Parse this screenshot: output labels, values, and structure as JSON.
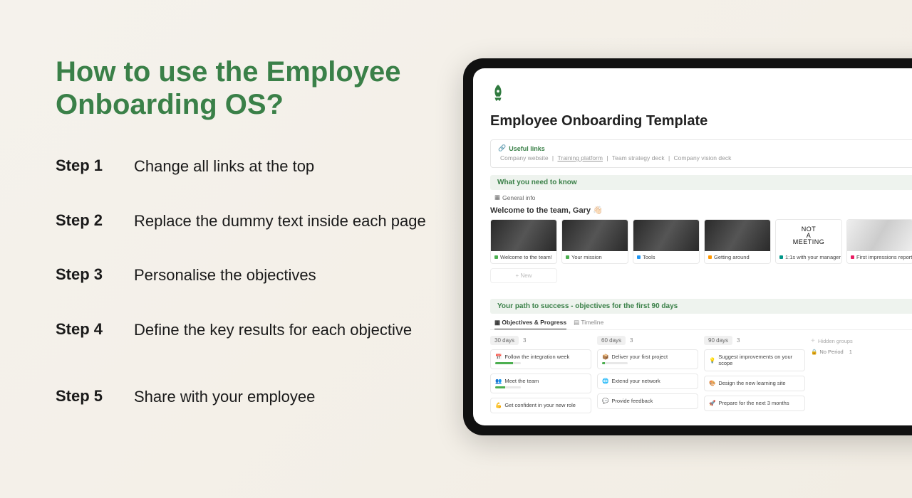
{
  "title": "How to use the Employee Onboarding OS?",
  "steps": [
    {
      "label": "Step 1",
      "text": "Change all links at the top"
    },
    {
      "label": "Step 2",
      "text": "Replace the dummy text inside each page"
    },
    {
      "label": "Step 3",
      "text": "Personalise the objectives"
    },
    {
      "label": "Step 4",
      "text": "Define the key results for each objective"
    },
    {
      "label": "Step 5",
      "text": "Share with your employee"
    }
  ],
  "screen": {
    "page_title": "Employee Onboarding Template",
    "useful": {
      "heading": "Useful links",
      "links": [
        "Company website",
        "Training platform",
        "Team strategy deck",
        "Company vision deck"
      ]
    },
    "know": {
      "heading": "What you need to know",
      "general": "General info",
      "welcome": "Welcome to the team, Gary 👋🏻",
      "cards": [
        "Welcome to the team!",
        "Your mission",
        "Tools",
        "Getting around",
        "1:1s with your manager",
        "First impressions report"
      ],
      "new_btn": "+  New",
      "meeting_text": "NOT\nA\nMEETING"
    },
    "path": {
      "heading": "Your path to success - objectives for the first 90 days",
      "tabs": {
        "active": "Objectives & Progress",
        "other": "Timeline"
      },
      "columns": [
        {
          "title": "30 days",
          "count": "3",
          "items": [
            "Follow the integration week",
            "Meet the team",
            "Get confident in your new role"
          ]
        },
        {
          "title": "60 days",
          "count": "3",
          "items": [
            "Deliver your first project",
            "Extend your network",
            "Provide feedback"
          ]
        },
        {
          "title": "90 days",
          "count": "3",
          "items": [
            "Suggest improvements on your scope",
            "Design the new learning site",
            "Prepare for the next 3 months"
          ]
        }
      ],
      "hidden": "Hidden groups",
      "noperiod": "No Period",
      "noperiod_count": "1"
    }
  }
}
